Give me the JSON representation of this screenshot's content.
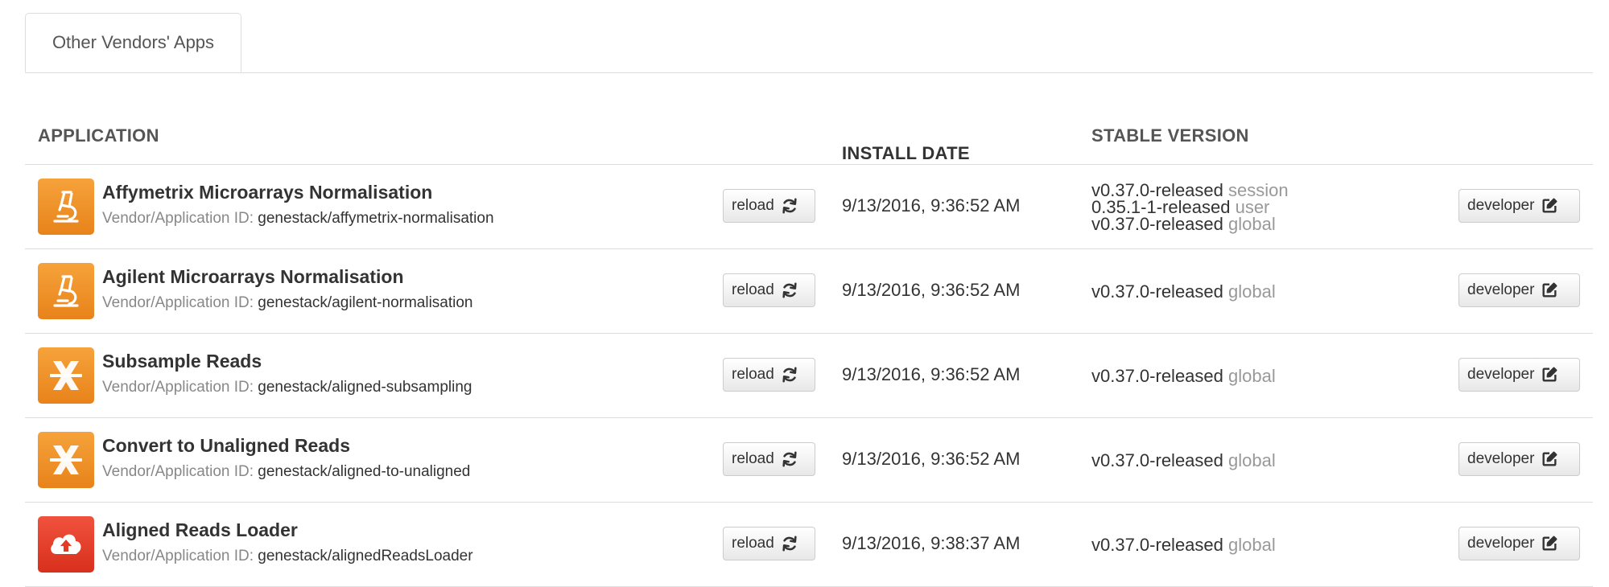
{
  "tabs": [
    {
      "label": "Other Vendors' Apps",
      "active": true
    }
  ],
  "table": {
    "headers": {
      "application": "APPLICATION",
      "install_date": "INSTALL DATE",
      "stable_version": "STABLE VERSION"
    },
    "id_label": "Vendor/Application ID:",
    "reload_label": "reload",
    "developer_label": "developer",
    "rows": [
      {
        "name": "Affymetrix Microarrays Normalisation",
        "app_id": "genestack/affymetrix-normalisation",
        "icon": "microscope-icon",
        "icon_color": "#f0921f",
        "install_date": "9/13/2016, 9:36:52 AM",
        "versions": [
          {
            "version": "v0.37.0-released",
            "scope": "session"
          },
          {
            "version": "0.35.1-1-released",
            "scope": "user"
          },
          {
            "version": "v0.37.0-released",
            "scope": "global"
          }
        ]
      },
      {
        "name": "Agilent Microarrays Normalisation",
        "app_id": "genestack/agilent-normalisation",
        "icon": "microscope-icon",
        "icon_color": "#f0921f",
        "install_date": "9/13/2016, 9:36:52 AM",
        "versions": [
          {
            "version": "v0.37.0-released",
            "scope": "global"
          }
        ]
      },
      {
        "name": "Subsample Reads",
        "app_id": "genestack/aligned-subsampling",
        "icon": "reads-tool-icon",
        "icon_color": "#f0921f",
        "install_date": "9/13/2016, 9:36:52 AM",
        "versions": [
          {
            "version": "v0.37.0-released",
            "scope": "global"
          }
        ]
      },
      {
        "name": "Convert to Unaligned Reads",
        "app_id": "genestack/aligned-to-unaligned",
        "icon": "reads-tool-icon",
        "icon_color": "#f0921f",
        "install_date": "9/13/2016, 9:36:52 AM",
        "versions": [
          {
            "version": "v0.37.0-released",
            "scope": "global"
          }
        ]
      },
      {
        "name": "Aligned Reads Loader",
        "app_id": "genestack/alignedReadsLoader",
        "icon": "cloud-upload-icon",
        "icon_color": "#e23b26",
        "install_date": "9/13/2016, 9:38:37 AM",
        "versions": [
          {
            "version": "v0.37.0-released",
            "scope": "global"
          }
        ]
      }
    ]
  }
}
